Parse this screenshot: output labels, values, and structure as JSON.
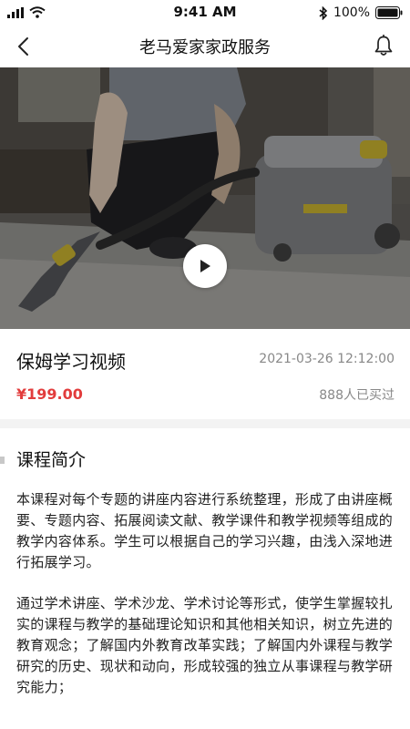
{
  "status_bar": {
    "time": "9:41 AM",
    "battery": "100%",
    "icons": [
      "signal-icon",
      "wifi-icon",
      "bluetooth-icon",
      "battery-icon"
    ]
  },
  "nav": {
    "title": "老马爱家家政服务",
    "back_icon": "back-chevron-icon",
    "bell_icon": "bell-icon"
  },
  "video": {
    "play_icon": "play-icon"
  },
  "course": {
    "title": "保姆学习视频",
    "date": "2021-03-26 12:12:00",
    "price": "¥199.00",
    "buyers": "888人已买过"
  },
  "intro": {
    "heading": "课程简介",
    "paragraphs": [
      "本课程对每个专题的讲座内容进行系统整理，形成了由讲座概要、专题内容、拓展阅读文献、教学课件和教学视频等组成的教学内容体系。学生可以根据自己的学习兴趣，由浅入深地进行拓展学习。",
      "通过学术讲座、学术沙龙、学术讨论等形式，使学生掌握较扎实的课程与教学的基础理论知识和其他相关知识，树立先进的教育观念；了解国内外教育改革实践；了解国内外课程与教学研究的历史、现状和动向，形成较强的独立从事课程与教学研究能力；"
    ]
  },
  "colors": {
    "price": "#e23c3c",
    "muted": "#888888",
    "divider": "#f3f3f3"
  }
}
